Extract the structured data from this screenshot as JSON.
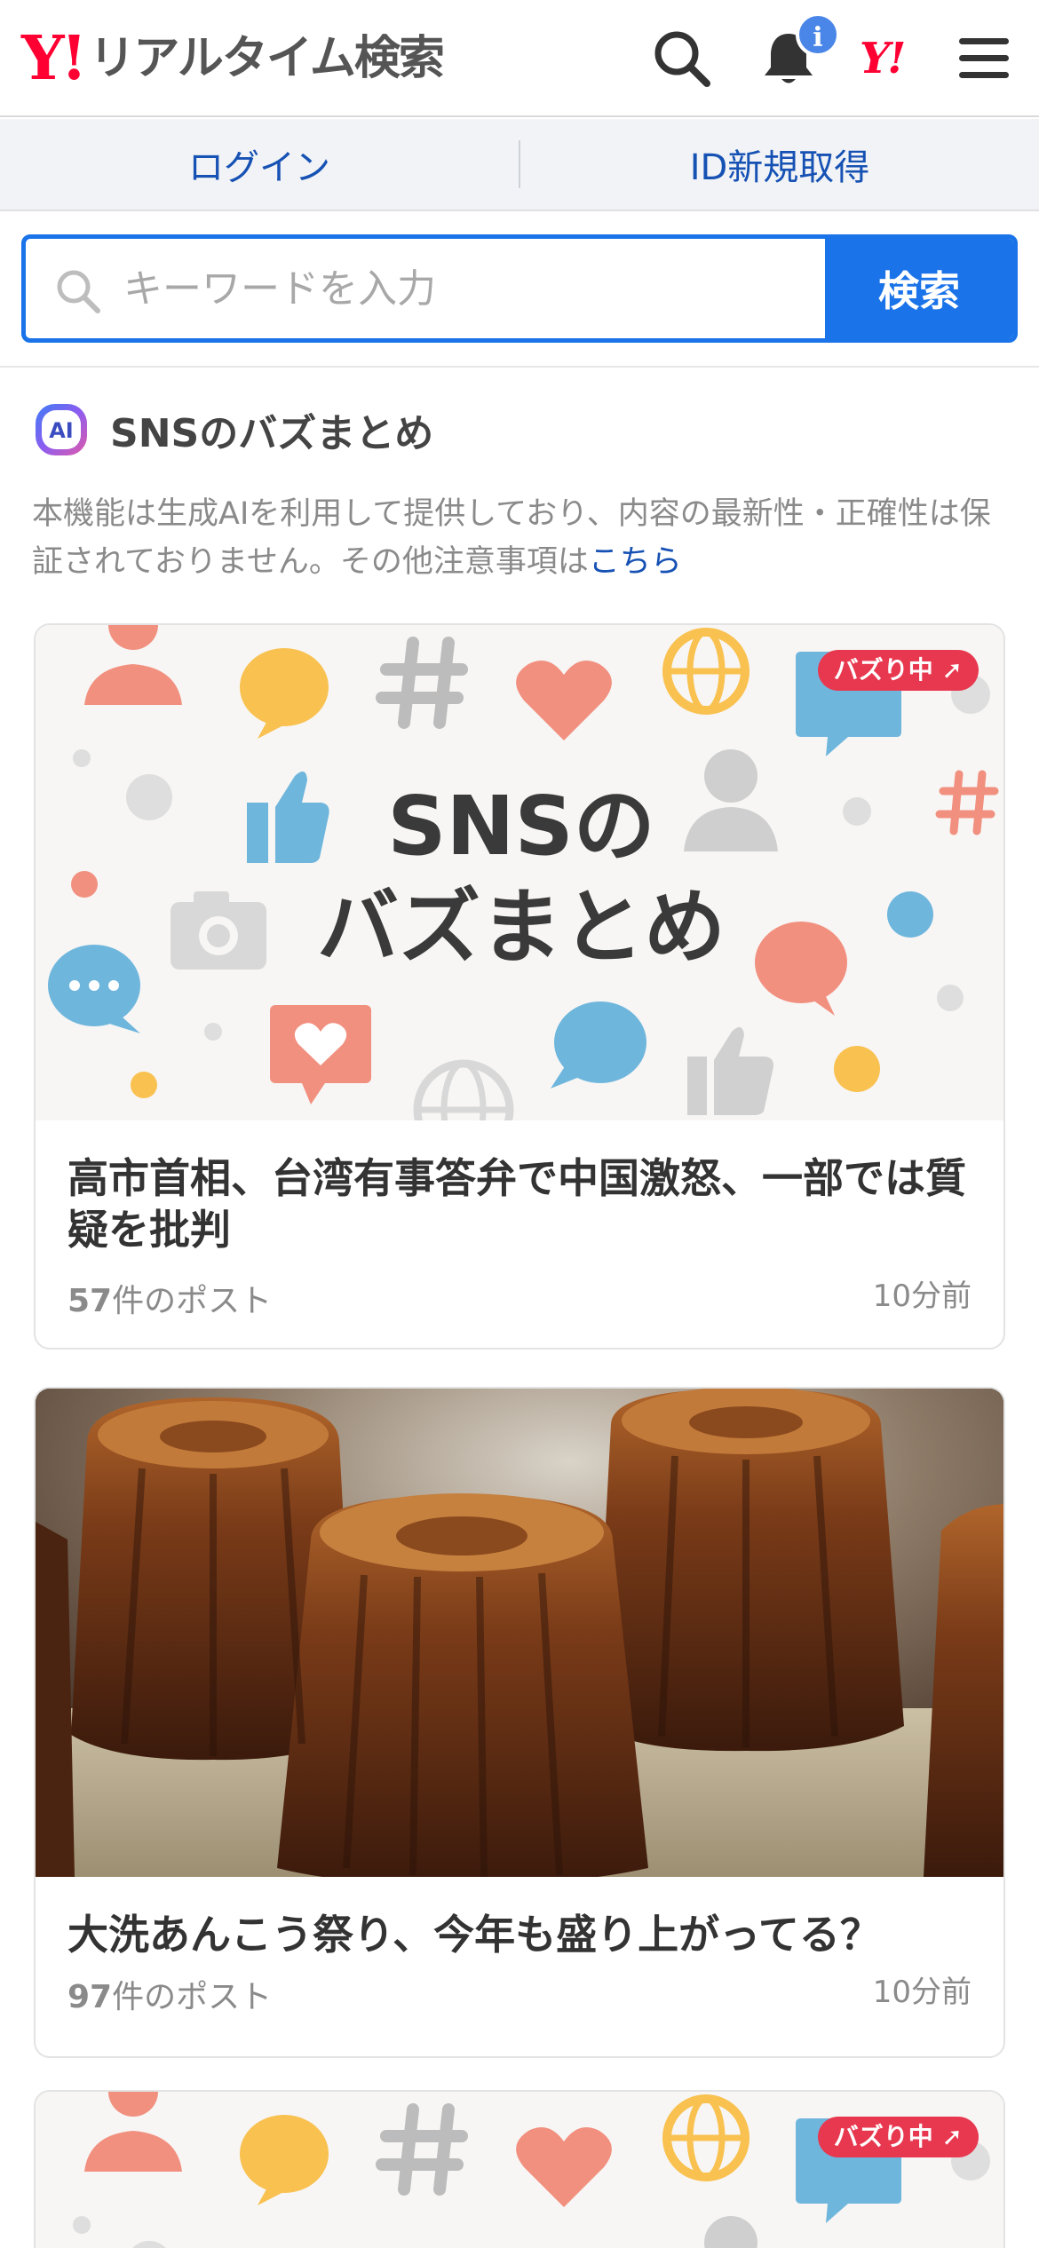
{
  "header": {
    "logo_mark": "Y!",
    "logo_text": "リアルタイム検索",
    "notification_badge": "i",
    "yahoo_link": "Y!"
  },
  "auth": {
    "login_label": "ログイン",
    "register_label": "ID新規取得"
  },
  "search": {
    "placeholder": "キーワードを入力",
    "value": "",
    "button_label": "検索"
  },
  "section": {
    "title": "SNSのバズまとめ",
    "ai_badge": "AI",
    "notice_text": "本機能は生成AIを利用して提供しており、内容の最新性・正確性は保証されておりません。その他注意事項は",
    "notice_link": "こちら"
  },
  "cards": [
    {
      "image_kind": "illustration",
      "image_title_line1": "SNSの",
      "image_title_line2": "バズまとめ",
      "badge": "バズり中",
      "title": "高市首相、台湾有事答弁で中国激怒、一部では質疑を批判",
      "post_count": "57",
      "post_suffix": "件のポスト",
      "time": "10分前"
    },
    {
      "image_kind": "photo",
      "title": "大洗あんこう祭り、今年も盛り上がってる？",
      "post_count": "97",
      "post_suffix": "件のポスト",
      "time": "10分前"
    },
    {
      "image_kind": "illustration",
      "badge": "バズり中"
    }
  ],
  "colors": {
    "brand_red": "#ff0033",
    "accent_blue": "#1a73e8",
    "link_blue": "#1651b4",
    "buzz_red": "#e8384f"
  }
}
